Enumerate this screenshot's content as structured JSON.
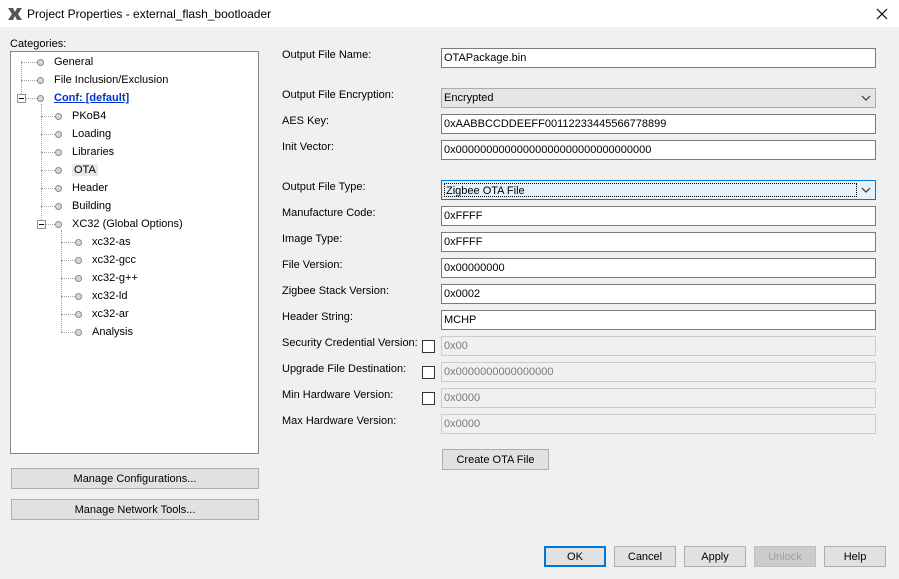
{
  "window": {
    "title": "Project Properties - external_flash_bootloader"
  },
  "categories": {
    "label": "Categories:",
    "items": [
      {
        "label": "General"
      },
      {
        "label": "File Inclusion/Exclusion"
      },
      {
        "label": "Conf: [default]"
      },
      {
        "label": "PKoB4"
      },
      {
        "label": "Loading"
      },
      {
        "label": "Libraries"
      },
      {
        "label": "OTA"
      },
      {
        "label": "Header"
      },
      {
        "label": "Building"
      },
      {
        "label": "XC32 (Global Options)"
      },
      {
        "label": "xc32-as"
      },
      {
        "label": "xc32-gcc"
      },
      {
        "label": "xc32-g++"
      },
      {
        "label": "xc32-ld"
      },
      {
        "label": "xc32-ar"
      },
      {
        "label": "Analysis"
      }
    ],
    "selected": "OTA"
  },
  "side_buttons": {
    "manage_configurations": "Manage Configurations...",
    "manage_network_tools": "Manage Network Tools..."
  },
  "form": {
    "output_file_name": {
      "label": "Output File Name:",
      "value": "OTAPackage.bin"
    },
    "output_file_encryption": {
      "label": "Output File Encryption:",
      "value": "Encrypted"
    },
    "aes_key": {
      "label": "AES Key:",
      "value": "0xAABBCCDDEEFF00112233445566778899"
    },
    "init_vector": {
      "label": "Init Vector:",
      "value": "0x00000000000000000000000000000000"
    },
    "output_file_type": {
      "label": "Output File Type:",
      "value": "Zigbee OTA File"
    },
    "manufacture_code": {
      "label": "Manufacture Code:",
      "value": "0xFFFF"
    },
    "image_type": {
      "label": "Image Type:",
      "value": "0xFFFF"
    },
    "file_version": {
      "label": "File Version:",
      "value": "0x00000000"
    },
    "zigbee_stack_version": {
      "label": "Zigbee Stack Version:",
      "value": "0x0002"
    },
    "header_string": {
      "label": "Header String:",
      "value": "MCHP"
    },
    "security_credential_version": {
      "label": "Security Credential Version:",
      "value": "0x00",
      "checked": false
    },
    "upgrade_file_destination": {
      "label": "Upgrade File Destination:",
      "value": "0x0000000000000000",
      "checked": false
    },
    "min_hardware_version": {
      "label": "Min Hardware Version:",
      "value": "0x0000",
      "checked": false
    },
    "max_hardware_version": {
      "label": "Max Hardware Version:",
      "value": "0x0000"
    },
    "create_ota_file": "Create OTA File"
  },
  "footer": {
    "ok": "OK",
    "cancel": "Cancel",
    "apply": "Apply",
    "unlock": "Unlock",
    "help": "Help"
  }
}
